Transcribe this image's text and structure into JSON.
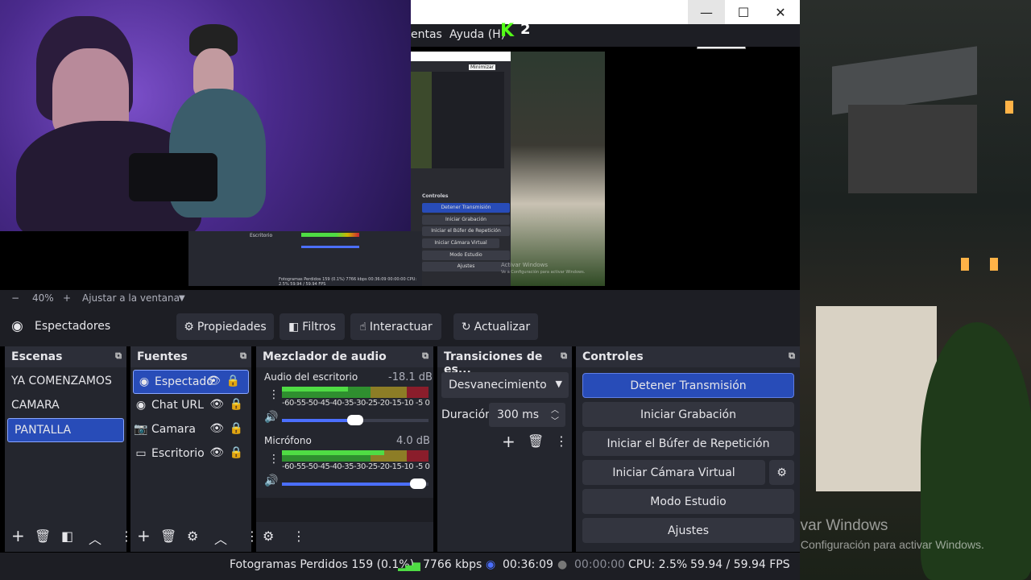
{
  "window": {
    "menu_partial": "entas",
    "menu_help": "Ayuda (H)",
    "tooltip": "Minimizar",
    "minimize_glyph": "—",
    "maximize_glyph": "☐",
    "close_glyph": "✕"
  },
  "kick_badge": {
    "logo": "K",
    "count": "2"
  },
  "nested_preview": {
    "tooltip": "Minimizar",
    "controls_title": "Controles",
    "buttons": [
      "Detener Transmisión",
      "Iniciar Grabación",
      "Iniciar el Búfer de Repetición",
      "Iniciar Cámara Virtual",
      "Modo Estudio",
      "Ajustes"
    ],
    "source_label": "Escritorio",
    "status": "Fotogramas Perdidos 159 (0.1%)    7766 kbps    00:36:09    00:00:00    CPU: 2.5%    59.94 / 59.94 FPS",
    "activate": "Activar Windows",
    "activate_sub": "Ve a Configuración para activar Windows."
  },
  "zoom": {
    "minus": "−",
    "level": "40%",
    "plus": "+",
    "fit_label": "Ajustar a la ventana",
    "arrow": "▼"
  },
  "toolbar": {
    "current_source": "Espectadores",
    "properties": "Propiedades",
    "filters": "Filtros",
    "interact": "Interactuar",
    "refresh": "Actualizar"
  },
  "scenes": {
    "title": "Escenas",
    "items": [
      "YA COMENZAMOS",
      "CAMARA",
      "PANTALLA"
    ],
    "active_index": 2
  },
  "sources": {
    "title": "Fuentes",
    "items": [
      {
        "label": "Espectado",
        "icon": "globe-icon"
      },
      {
        "label": "Chat URL",
        "icon": "globe-icon"
      },
      {
        "label": "Camara",
        "icon": "camera-icon"
      },
      {
        "label": "Escritorio",
        "icon": "monitor-icon"
      }
    ]
  },
  "mixer": {
    "title": "Mezclador de audio",
    "channels": [
      {
        "name": "Audio del escritorio",
        "db": "-18.1 dB",
        "level": 0.45,
        "volume": 0.5
      },
      {
        "name": "Micrófono",
        "db": "4.0 dB",
        "level": 0.7,
        "volume": 0.93
      }
    ],
    "scale": "-60-55-50-45-40-35-30-25-20-15-10 -5  0"
  },
  "transitions": {
    "title": "Transiciones de es...",
    "selected": "Desvanecimiento",
    "duration_label": "Duración",
    "duration_value": "300 ms"
  },
  "controls": {
    "title": "Controles",
    "stop_stream": "Detener Transmisión",
    "start_recording": "Iniciar Grabación",
    "start_replay": "Iniciar el Búfer de Repetición",
    "start_vcam": "Iniciar Cámara Virtual",
    "studio_mode": "Modo Estudio",
    "settings": "Ajustes"
  },
  "status": {
    "dropped": "Fotogramas Perdidos 159 (0.1%)",
    "bitrate": "7766 kbps",
    "stream_time": "00:36:09",
    "rec_time": "00:00:00",
    "cpu": "CPU: 2.5%",
    "fps": "59.94 / 59.94 FPS"
  },
  "watermark": {
    "line1": "Activar Windows",
    "line2": "Ve a Configuración para activar Windows."
  },
  "colors": {
    "accent": "#284cb8",
    "panel": "#24262e",
    "header": "#2c2e38",
    "kick_green": "#53fc18"
  }
}
